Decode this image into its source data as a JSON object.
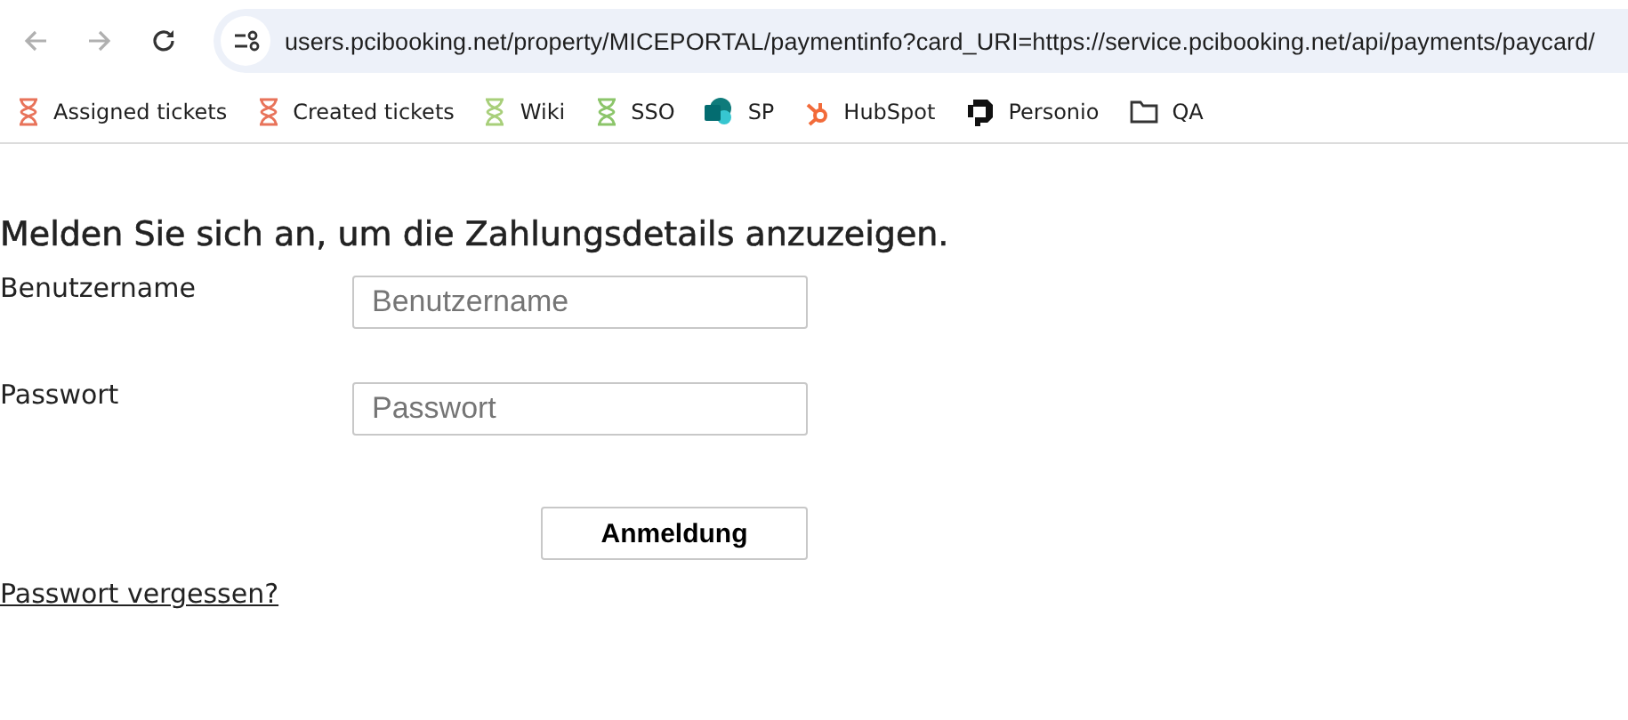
{
  "browser": {
    "url": "users.pcibooking.net/property/MICEPORTAL/paymentinfo?card_URI=https://service.pcibooking.net/api/payments/paycard/",
    "bookmarks": [
      {
        "label": "Assigned tickets",
        "kind": "ticket",
        "color": "#e8735a"
      },
      {
        "label": "Created tickets",
        "kind": "ticket",
        "color": "#e8735a"
      },
      {
        "label": "Wiki",
        "kind": "ticket",
        "color": "#a8cf7a"
      },
      {
        "label": "SSO",
        "kind": "ticket",
        "color": "#8cc56a"
      },
      {
        "label": "SP",
        "kind": "sharepoint",
        "color": "#0f7b7b"
      },
      {
        "label": "HubSpot",
        "kind": "hubspot",
        "color": "#f26b3a"
      },
      {
        "label": "Personio",
        "kind": "personio",
        "color": "#111111"
      },
      {
        "label": "QA",
        "kind": "folder",
        "color": "#333333"
      }
    ]
  },
  "page": {
    "heading": "Melden Sie sich an, um die Zahlungsdetails anzuzeigen.",
    "fields": [
      {
        "label": "Benutzername",
        "placeholder": "Benutzername"
      },
      {
        "label": "Passwort",
        "placeholder": "Passwort"
      }
    ],
    "submit": "Anmeldung",
    "forgot_link": "Passwort vergessen?"
  }
}
